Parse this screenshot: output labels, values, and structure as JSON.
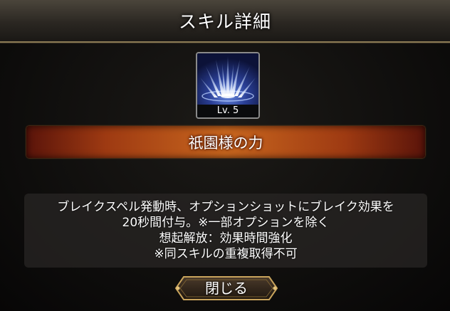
{
  "dialog": {
    "title": "スキル詳細"
  },
  "skill": {
    "icon": "ice-shard-burst-icon",
    "level": "Lv. 5",
    "name": "祇園様の力",
    "description_lines": [
      "ブレイクスペル発動時、オプションショットにブレイク効果を",
      "20秒間付与。※一部オプションを除く",
      "想起解放：効果時間強化",
      "※同スキルの重複取得不可"
    ]
  },
  "buttons": {
    "close_label": "閉じる"
  },
  "colors": {
    "title_border": "#8a7a54",
    "banner_center": "#c8661e",
    "banner_edge": "#5a140a",
    "button_border": "#c9a45c",
    "icon_accent": "#8fb6ff"
  }
}
